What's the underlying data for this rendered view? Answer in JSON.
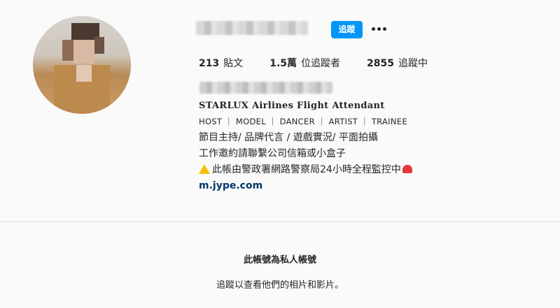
{
  "profile": {
    "follow_label": "追蹤",
    "more_icon": "more-options-icon",
    "stats": {
      "posts_value": "213",
      "posts_label": "貼文",
      "followers_value": "1.5萬",
      "followers_label": "位追蹤者",
      "following_value": "2855",
      "following_label": "追蹤中"
    },
    "bio": {
      "headline": "STARLUX Airlines Flight Attendant",
      "tags": "HOST ｜ MODEL ｜ DANCER ｜ ARTIST ｜ TRAINEE",
      "line1": "節目主持/ 品牌代言 / 遊戲實況/ 平面拍攝",
      "line2": "工作邀約請聯繫公司信箱或小盒子",
      "warning": "此帳由警政署網路警察局24小時全程監控中",
      "link": "m.jype.com"
    }
  },
  "private_notice": {
    "title": "此帳號為私人帳號",
    "subtitle": "追蹤以查看他們的相片和影片。"
  },
  "colors": {
    "accent": "#0095f6",
    "link": "#00376b",
    "background": "#fafafa"
  }
}
